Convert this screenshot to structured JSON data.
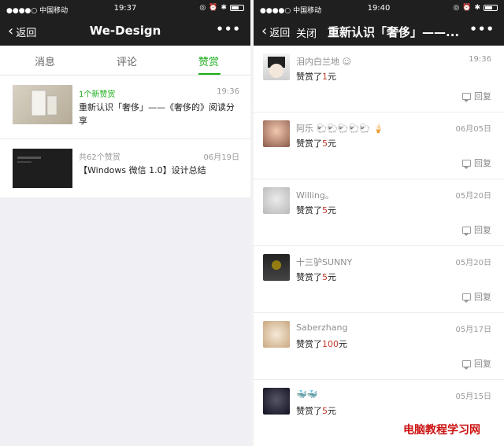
{
  "status_left": {
    "carrier": "●●●●○ 中国移动",
    "time": "19:37"
  },
  "status_right": {
    "carrier": "●●●●○ 中国移动",
    "time": "19:40"
  },
  "left": {
    "back_label": "返回",
    "title": "We-Design",
    "more_label": "•••",
    "tabs": [
      {
        "label": "消息"
      },
      {
        "label": "评论"
      },
      {
        "label": "赞赏"
      }
    ],
    "rows": [
      {
        "top": "1个新赞赏",
        "time": "19:36",
        "title": "重新认识「奢侈」——《奢侈的》阅读分享"
      },
      {
        "top": "共62个赞赏",
        "time": "06月19日",
        "title": "【Windows 微信 1.0】设计总结"
      }
    ]
  },
  "right": {
    "back_label": "返回",
    "close_label": "关闭",
    "title": "重新认识「奢侈」——...",
    "more_label": "•••",
    "reply_label": "回复",
    "items": [
      {
        "name": "泪内白兰地 ☺",
        "date": "19:36",
        "prefix": "赞赏了",
        "amount": "1",
        "unit": "元"
      },
      {
        "name": "阿乐 🐑🐑🐑🐑🐑 🍦",
        "date": "06月05日",
        "prefix": "赞赏了",
        "amount": "5",
        "unit": "元"
      },
      {
        "name": "Willing。",
        "date": "05月20日",
        "prefix": "赞赏了",
        "amount": "5",
        "unit": "元"
      },
      {
        "name": "十三驴SUNNY",
        "date": "05月20日",
        "prefix": "赞赏了",
        "amount": "5",
        "unit": "元"
      },
      {
        "name": "Saberzhang",
        "date": "05月17日",
        "prefix": "赞赏了",
        "amount": "100",
        "unit": "元"
      },
      {
        "name": "🐳🐳",
        "date": "05月15日",
        "prefix": "赞赏了",
        "amount": "5",
        "unit": "元"
      }
    ]
  },
  "watermark": "电脑教程学习网",
  "colors": {
    "accent": "#1aad19",
    "navbar": "#1f1f1f",
    "amount": "#c0392b"
  }
}
